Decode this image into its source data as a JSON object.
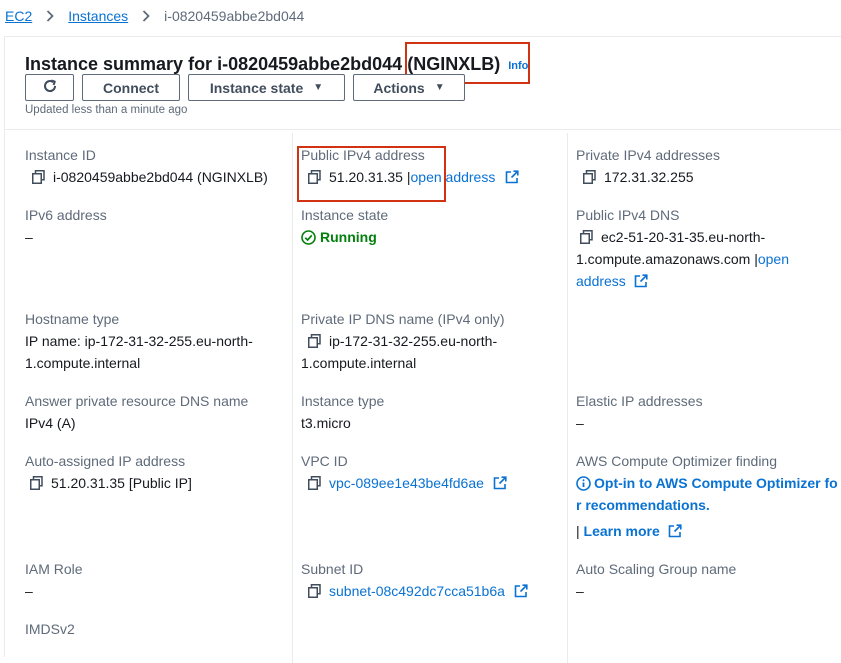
{
  "breadcrumb": {
    "root": "EC2",
    "parent": "Instances",
    "current": "i-0820459abbe2bd044"
  },
  "header": {
    "title": "Instance summary for i-0820459abbe2bd044",
    "name": "(NGINXLB)",
    "info": "Info",
    "updated": "Updated less than a minute ago"
  },
  "toolbar": {
    "refresh_icon": "refresh-icon",
    "connect": "Connect",
    "instance_state": "Instance state",
    "actions": "Actions"
  },
  "details": {
    "instance_id": {
      "label": "Instance ID",
      "value": "i-0820459abbe2bd044 (NGINXLB)"
    },
    "public_ipv4": {
      "label": "Public IPv4 address",
      "value": "51.20.31.35",
      "sep": " |",
      "link": "open address"
    },
    "private_ipv4": {
      "label": "Private IPv4 addresses",
      "value": "172.31.32.255"
    },
    "ipv6": {
      "label": "IPv6 address",
      "value": "–"
    },
    "instance_state": {
      "label": "Instance state",
      "value": "Running"
    },
    "public_dns": {
      "label": "Public IPv4 DNS",
      "line1": "ec2-51-20-31-35.eu-north-",
      "line2": "1.compute.amazonaws.com",
      "sep": " |",
      "link1": "open",
      "link2": "address"
    },
    "hostname_type": {
      "label": "Hostname type",
      "line1": "IP name: ip-172-31-32-255.eu-north-",
      "line2": "1.compute.internal"
    },
    "private_dns": {
      "label": "Private IP DNS name (IPv4 only)",
      "line1": "ip-172-31-32-255.eu-north-",
      "line2": "1.compute.internal"
    },
    "answer_dns": {
      "label": "Answer private resource DNS name",
      "value": "IPv4 (A)"
    },
    "instance_type": {
      "label": "Instance type",
      "value": "t3.micro"
    },
    "elastic_ip": {
      "label": "Elastic IP addresses",
      "value": "–"
    },
    "auto_ip": {
      "label": "Auto-assigned IP address",
      "value": "51.20.31.35 [Public IP]"
    },
    "vpc_id": {
      "label": "VPC ID",
      "value": "vpc-089ee1e43be4fd6ae"
    },
    "optimizer": {
      "label": "AWS Compute Optimizer finding",
      "line1": "Opt-in to AWS Compute Optimizer fo",
      "line2": "r recommendations.",
      "sep": "| ",
      "learn_more": "Learn more"
    },
    "iam_role": {
      "label": "IAM Role",
      "value": "–"
    },
    "subnet_id": {
      "label": "Subnet ID",
      "value": "subnet-08c492dc7cca51b6a"
    },
    "asg_name": {
      "label": "Auto Scaling Group name",
      "value": "–"
    },
    "imdsv2": {
      "label": "IMDSv2"
    }
  },
  "colors": {
    "link": "#0972d3",
    "success": "#037f0c",
    "highlight": "#d13212",
    "label": "#5f6b7a"
  }
}
